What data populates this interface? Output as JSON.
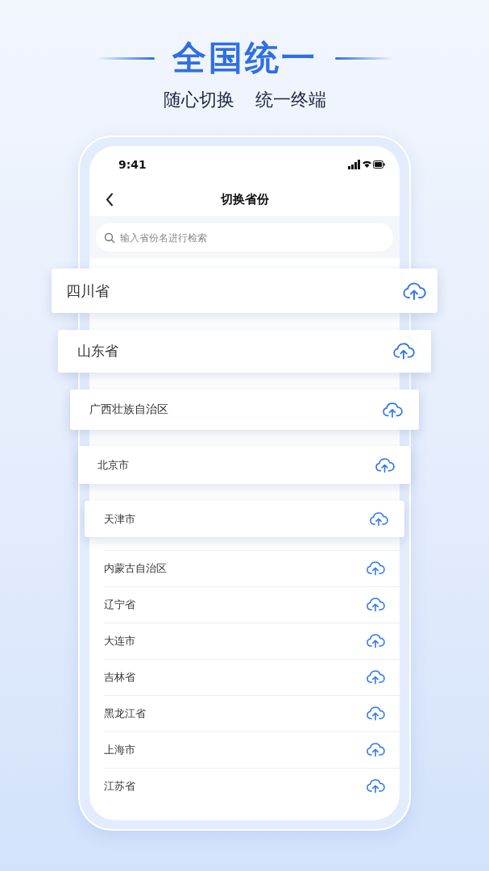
{
  "headline": "全国统一",
  "subtitles": [
    "随心切换",
    "统一终端"
  ],
  "status_bar": {
    "time": "9:41"
  },
  "nav": {
    "title": "切换省份"
  },
  "search": {
    "placeholder": "输入省份名进行检索"
  },
  "floating_provinces": [
    "四川省",
    "山东省",
    "广西壮族自治区",
    "北京市",
    "天津市"
  ],
  "provinces": [
    "内蒙古自治区",
    "辽宁省",
    "大连市",
    "吉林省",
    "黑龙江省",
    "上海市",
    "江苏省"
  ]
}
